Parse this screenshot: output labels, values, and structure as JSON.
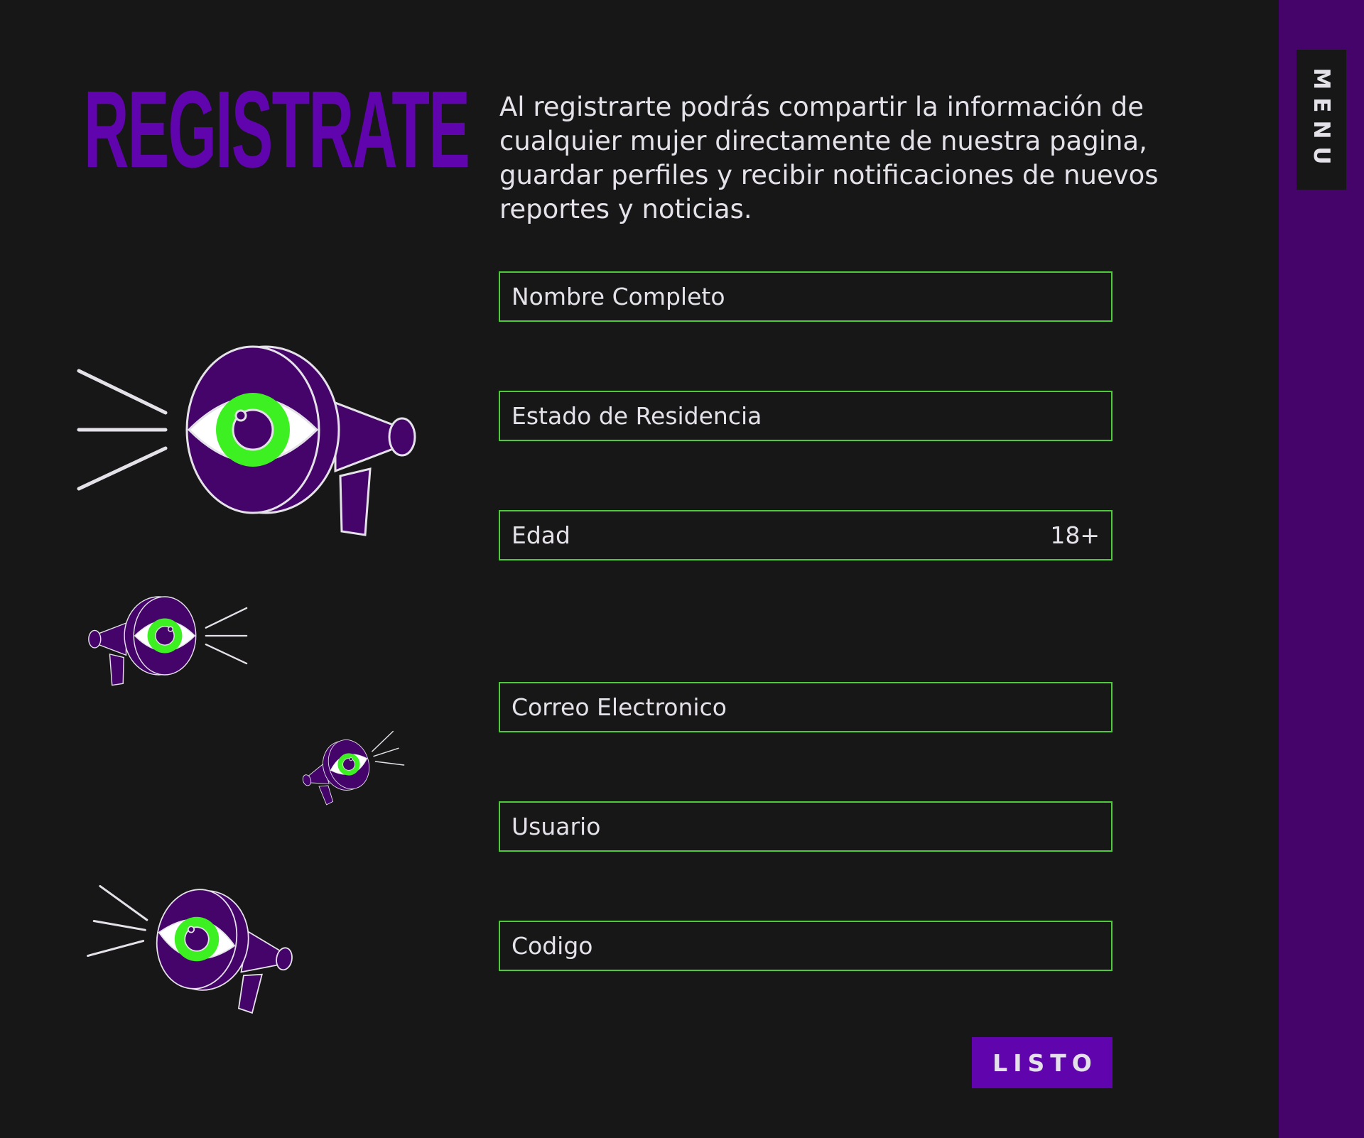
{
  "header": {
    "title": "REGISTRATE",
    "intro": "Al registrarte podrás compartir la información de cualquier mujer directamente de nuestra pagina, guardar perfiles y recibir notificaciones de nuevos reportes y noticias."
  },
  "sidebar": {
    "menu_label": "MENU"
  },
  "form": {
    "fields": [
      {
        "label": "Nombre Completo"
      },
      {
        "label": "Estado de Residencia"
      },
      {
        "label": "Edad",
        "hint": "18+"
      },
      {
        "label": "Correo Electronico"
      },
      {
        "label": "Usuario"
      },
      {
        "label": "Codigo"
      }
    ],
    "submit_label": "LISTO"
  },
  "illustrations": [
    {
      "icon": "megaphone-eye-icon"
    },
    {
      "icon": "megaphone-eye-icon"
    },
    {
      "icon": "megaphone-eye-icon"
    },
    {
      "icon": "megaphone-eye-icon"
    }
  ],
  "colors": {
    "background": "#181718",
    "accent_purple": "#6004ad",
    "sidebar_purple": "#44046a",
    "field_border_green": "#4fca3d",
    "eye_green": "#3df021",
    "text": "#e4e2e8"
  }
}
